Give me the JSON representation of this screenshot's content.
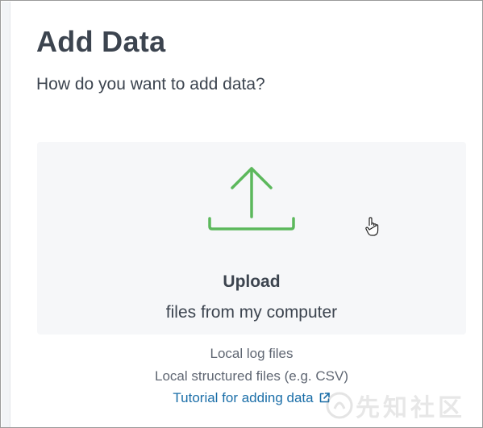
{
  "page": {
    "title": "Add Data",
    "subtitle": "How do you want to add data?"
  },
  "upload": {
    "title": "Upload",
    "subtitle": "files from my computer",
    "icon": "upload-icon",
    "accent_color": "#5cb85c"
  },
  "details": {
    "line1": "Local log files",
    "line2": "Local structured files (e.g. CSV)"
  },
  "tutorial": {
    "label": "Tutorial for adding data",
    "icon": "external-link-icon",
    "color": "#1a6ea8"
  },
  "watermark": {
    "text": "先知社区"
  }
}
